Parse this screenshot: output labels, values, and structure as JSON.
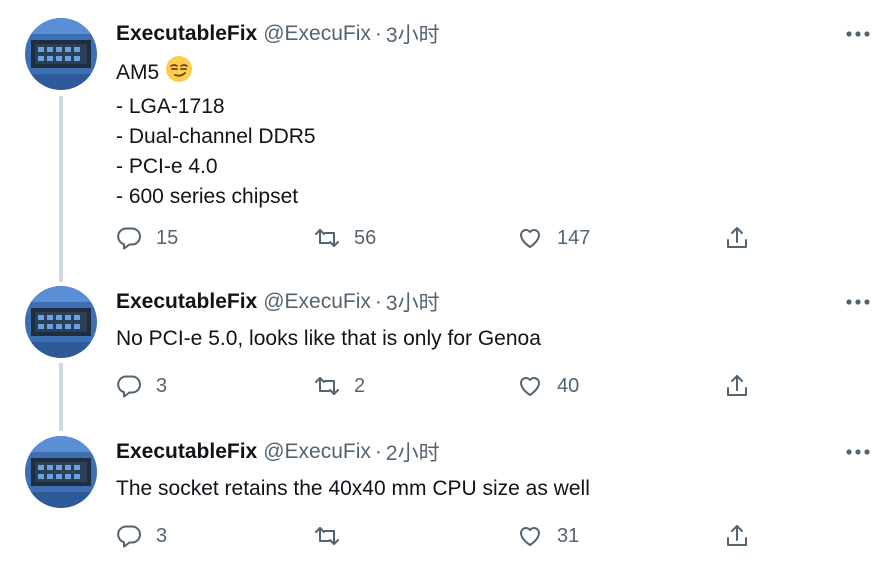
{
  "colors": {
    "text_primary": "#0f1419",
    "text_secondary": "#536471",
    "thread_line": "#cfd9de",
    "avatar_bg": "#3d6fb5"
  },
  "icons": {
    "reply": "speech-bubble-icon",
    "retweet": "retweet-arrows-icon",
    "like": "heart-icon",
    "share": "share-upload-icon",
    "more": "three-dots-icon"
  },
  "tweets": [
    {
      "display_name": "ExecutableFix",
      "handle": "@ExecuFix",
      "separator": "·",
      "time": "3小时",
      "lines": [
        "AM5",
        "- LGA-1718",
        "- Dual-channel DDR5",
        "- PCI-e 4.0",
        "- 600 series chipset"
      ],
      "emoji": "smirking-face",
      "replies": "15",
      "retweets": "56",
      "likes": "147"
    },
    {
      "display_name": "ExecutableFix",
      "handle": "@ExecuFix",
      "separator": "·",
      "time": "3小时",
      "lines": [
        "No PCI-e 5.0, looks like that is only for Genoa"
      ],
      "replies": "3",
      "retweets": "2",
      "likes": "40"
    },
    {
      "display_name": "ExecutableFix",
      "handle": "@ExecuFix",
      "separator": "·",
      "time": "2小时",
      "lines": [
        "The socket retains the 40x40 mm CPU size as well"
      ],
      "replies": "3",
      "retweets": "",
      "likes": "31"
    }
  ]
}
